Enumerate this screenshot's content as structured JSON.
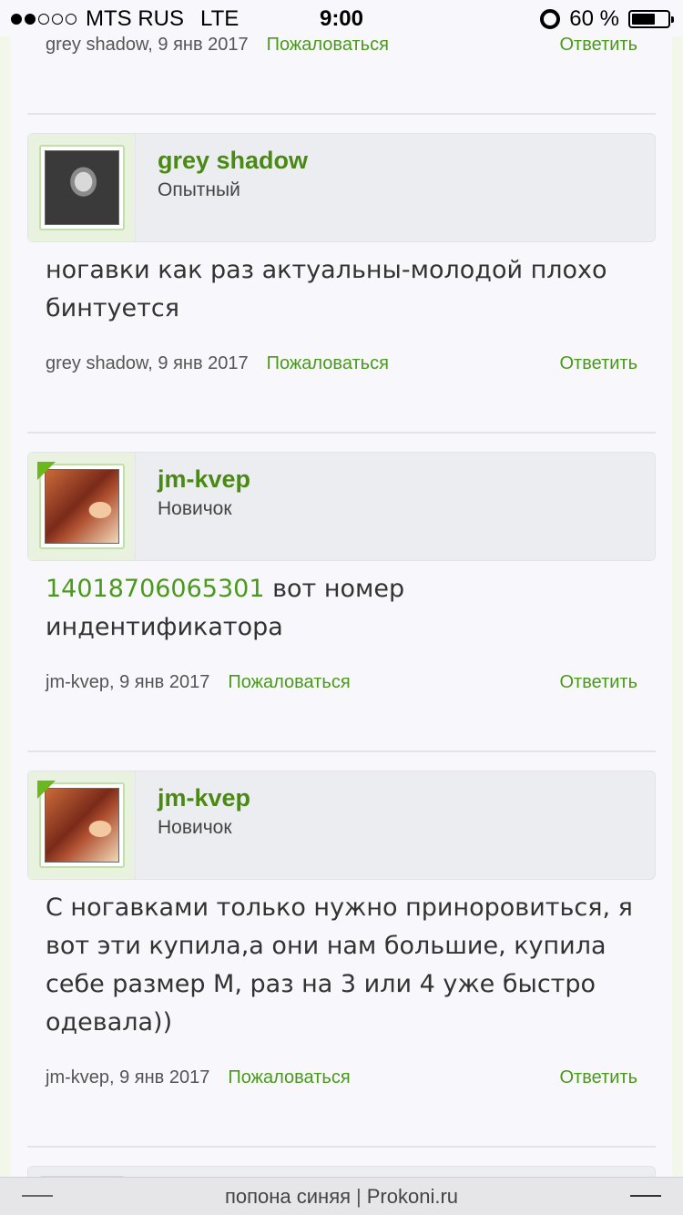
{
  "status_bar": {
    "carrier": "MTS RUS",
    "network": "LTE",
    "time": "9:00",
    "battery": "60 %",
    "battery_level": 0.6,
    "signal_bars": 2
  },
  "top_meta": {
    "author": "grey shadow, 9 янв 2017",
    "report": "Пожаловаться",
    "reply": "Ответить"
  },
  "comments": [
    {
      "username": "grey shadow",
      "rank": "Опытный",
      "avatar": "woman-portrait",
      "text": "ногавки как раз актуальны-молодой плохо бинтуется",
      "meta": {
        "author": "grey shadow, 9 янв 2017",
        "report": "Пожаловаться",
        "reply": "Ответить"
      }
    },
    {
      "username": "jm-kvep",
      "rank": "Новичок",
      "avatar": "horse-and-girl",
      "id_number": "14018706065301",
      "text": " вот номер индентификатора",
      "meta": {
        "author": "jm-kvep, 9 янв 2017",
        "report": "Пожаловаться",
        "reply": "Ответить"
      }
    },
    {
      "username": "jm-kvep",
      "rank": "Новичок",
      "avatar": "horse-and-girl",
      "text": "С ногавками только нужно приноровиться, я вот эти купила,а они нам большие, купила себе размер М, раз на 3 или 4 уже быстро одевала))",
      "meta": {
        "author": "jm-kvep, 9 янв 2017",
        "report": "Пожаловаться",
        "reply": "Ответить"
      }
    }
  ],
  "bottom_bar": {
    "page_title": "попона синяя",
    "separator": "|",
    "site": "Prokoni.ru"
  },
  "colors": {
    "accent": "#4a9a1a",
    "username": "#4a8a14",
    "new_flag": "#6ab81e"
  }
}
